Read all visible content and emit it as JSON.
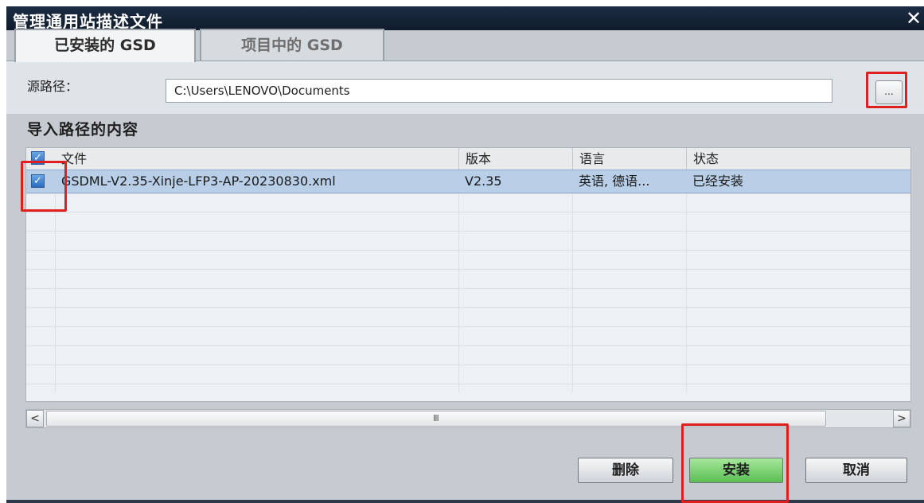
{
  "window": {
    "title": "管理通用站描述文件",
    "close_glyph": "✕"
  },
  "tabs": [
    {
      "label": "已安装的 GSD",
      "active": true
    },
    {
      "label": "项目中的 GSD",
      "active": false
    }
  ],
  "source": {
    "label": "源路径：",
    "value": "C:\\Users\\LENOVO\\Documents",
    "browse_label": "..."
  },
  "section_title": "导入路径的内容",
  "table": {
    "columns": [
      "文件",
      "版本",
      "语言",
      "状态"
    ],
    "rows": [
      {
        "checked": true,
        "file": "GSDML-V2.35-Xinje-LFP3-AP-20230830.xml",
        "version": "V2.35",
        "language": "英语, 德语...",
        "status": "已经安装"
      }
    ]
  },
  "scrollbar": {
    "left_glyph": "<",
    "right_glyph": ">",
    "grip_glyph": "III"
  },
  "buttons": {
    "delete": "删除",
    "install": "安装",
    "cancel": "取消"
  },
  "colors": {
    "titlebar": "#15233a",
    "selected_row": "#b9cfe8",
    "install_button": "#5bbd52",
    "annotation": "#e02020"
  }
}
